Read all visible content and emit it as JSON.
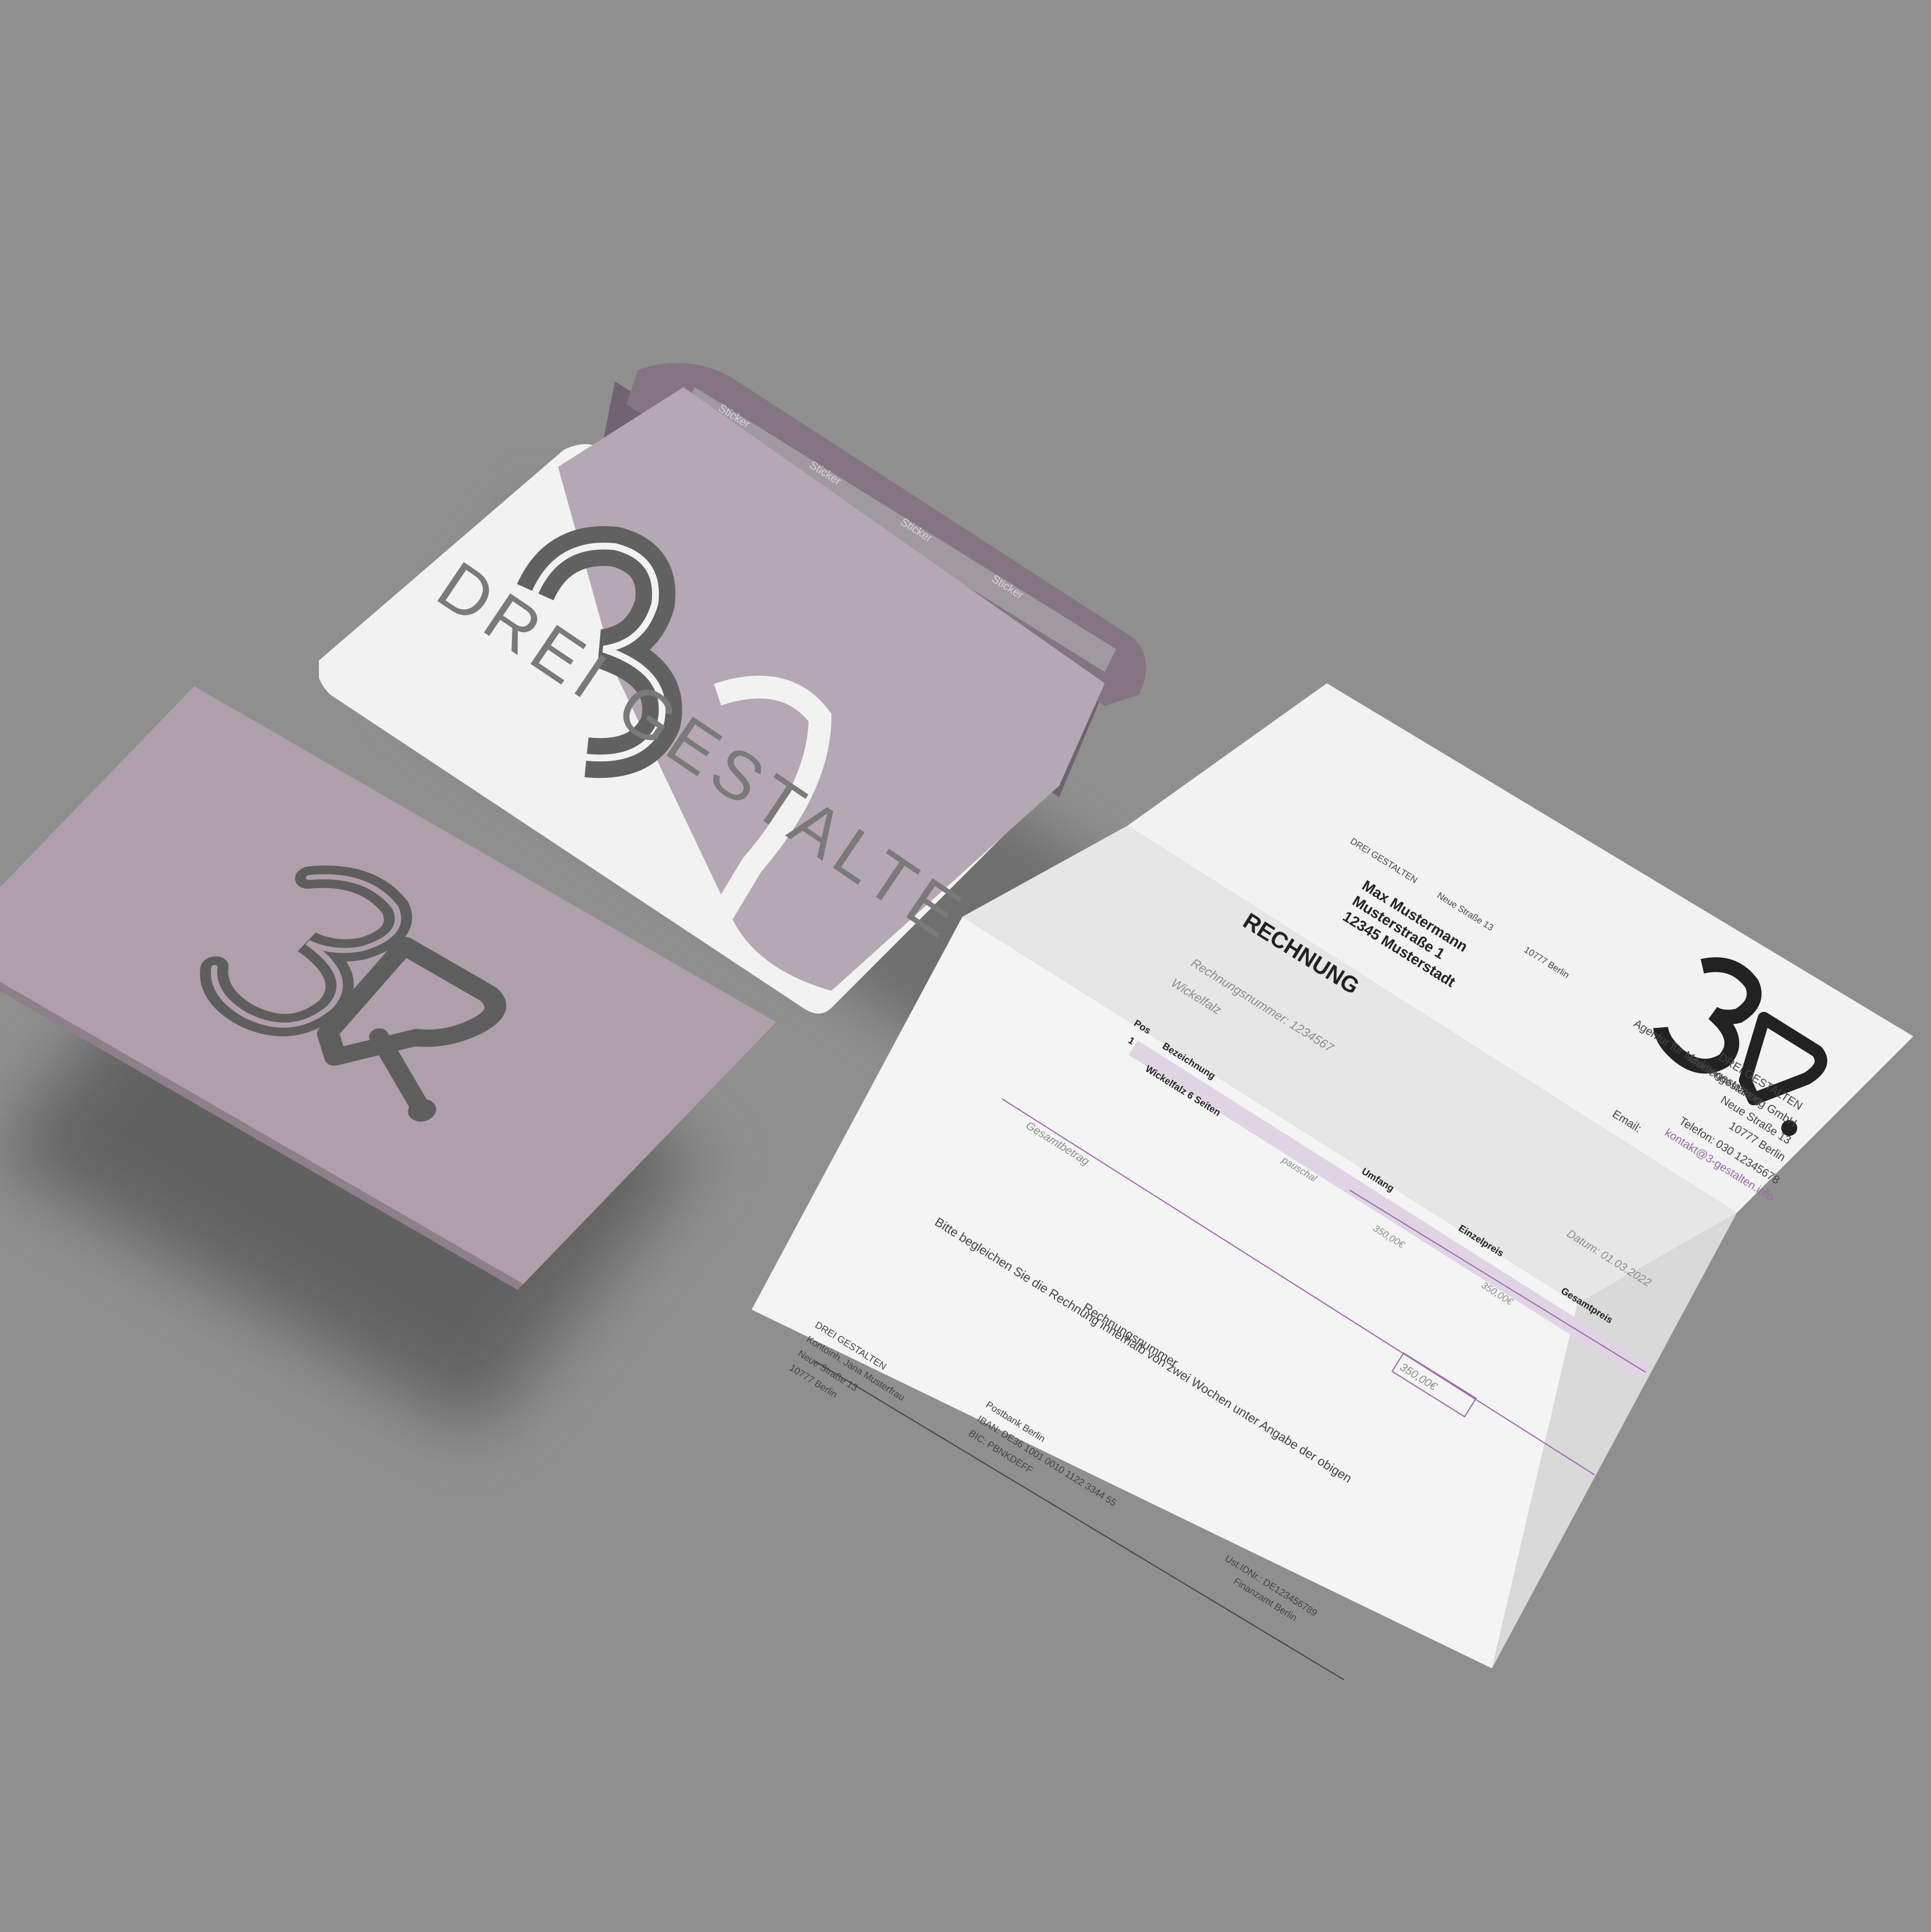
{
  "envelope": {
    "brand_text": "DREI GESTALTEN",
    "sticker_word": "Sticker"
  },
  "invoice": {
    "sender_line": {
      "name": "DREI GESTALTEN",
      "street": "Neue Straße 13",
      "city": "10777 Berlin"
    },
    "recipient": {
      "name": "Max Mustermann",
      "street": "Musterstraße 1",
      "city": "12345 Musterstadt"
    },
    "title": "RECHNUNG",
    "invoice_number": "Rechnungsnummer: 1234567",
    "subject": "Wickelfalz",
    "date": "Datum: 01.03.2022",
    "company": {
      "tagline": "Agentur für Mediengestaltung",
      "name": "DREI GESTALTEN",
      "legal": "Mediengestaltung GmbH",
      "street": "Neue Straße 13",
      "city": "10777 Berlin",
      "phone": "Telefon: 030 12345678",
      "email_label": "Email:",
      "email": "kontakt@3-gestalten.info"
    },
    "table": {
      "headers": [
        "Pos",
        "Bezeichnung",
        "Umfang",
        "Einzelpreis",
        "Gesamtpreis"
      ],
      "rows": [
        {
          "pos": "1",
          "desc": "Wickelfalz 6 Seiten",
          "scope": "pauschal",
          "unit": "350,00€",
          "total": "350,00€"
        }
      ]
    },
    "total_label": "Gesamtbetrag",
    "total_value": "350,00€",
    "payment_note_1": "Bitte begleichen Sie die Rechnung innerhalb von zwei Wochen unter Angabe der obigen",
    "payment_note_2": "Rechnungsnummer",
    "footer": {
      "col1": [
        "DREI GESTALTEN",
        "Kontoinh. Jana Musterfrau",
        "Neue Straße 13",
        "10777 Berlin"
      ],
      "col2": [
        "Postbank Berlin",
        "IBAN: DE36 1001 0010 1122 3344 55",
        "BIC: PBNKDEFF"
      ],
      "col3": [
        "Ust.IDNr.: DE123456789",
        "Finanzamt Berlin"
      ]
    }
  },
  "colors": {
    "background": "#8f8f8f",
    "mauve": "#ae9fab",
    "dark_mauve": "#857582",
    "logo_gray": "#5e5e5e",
    "accent_purple": "#9a6aa6"
  }
}
